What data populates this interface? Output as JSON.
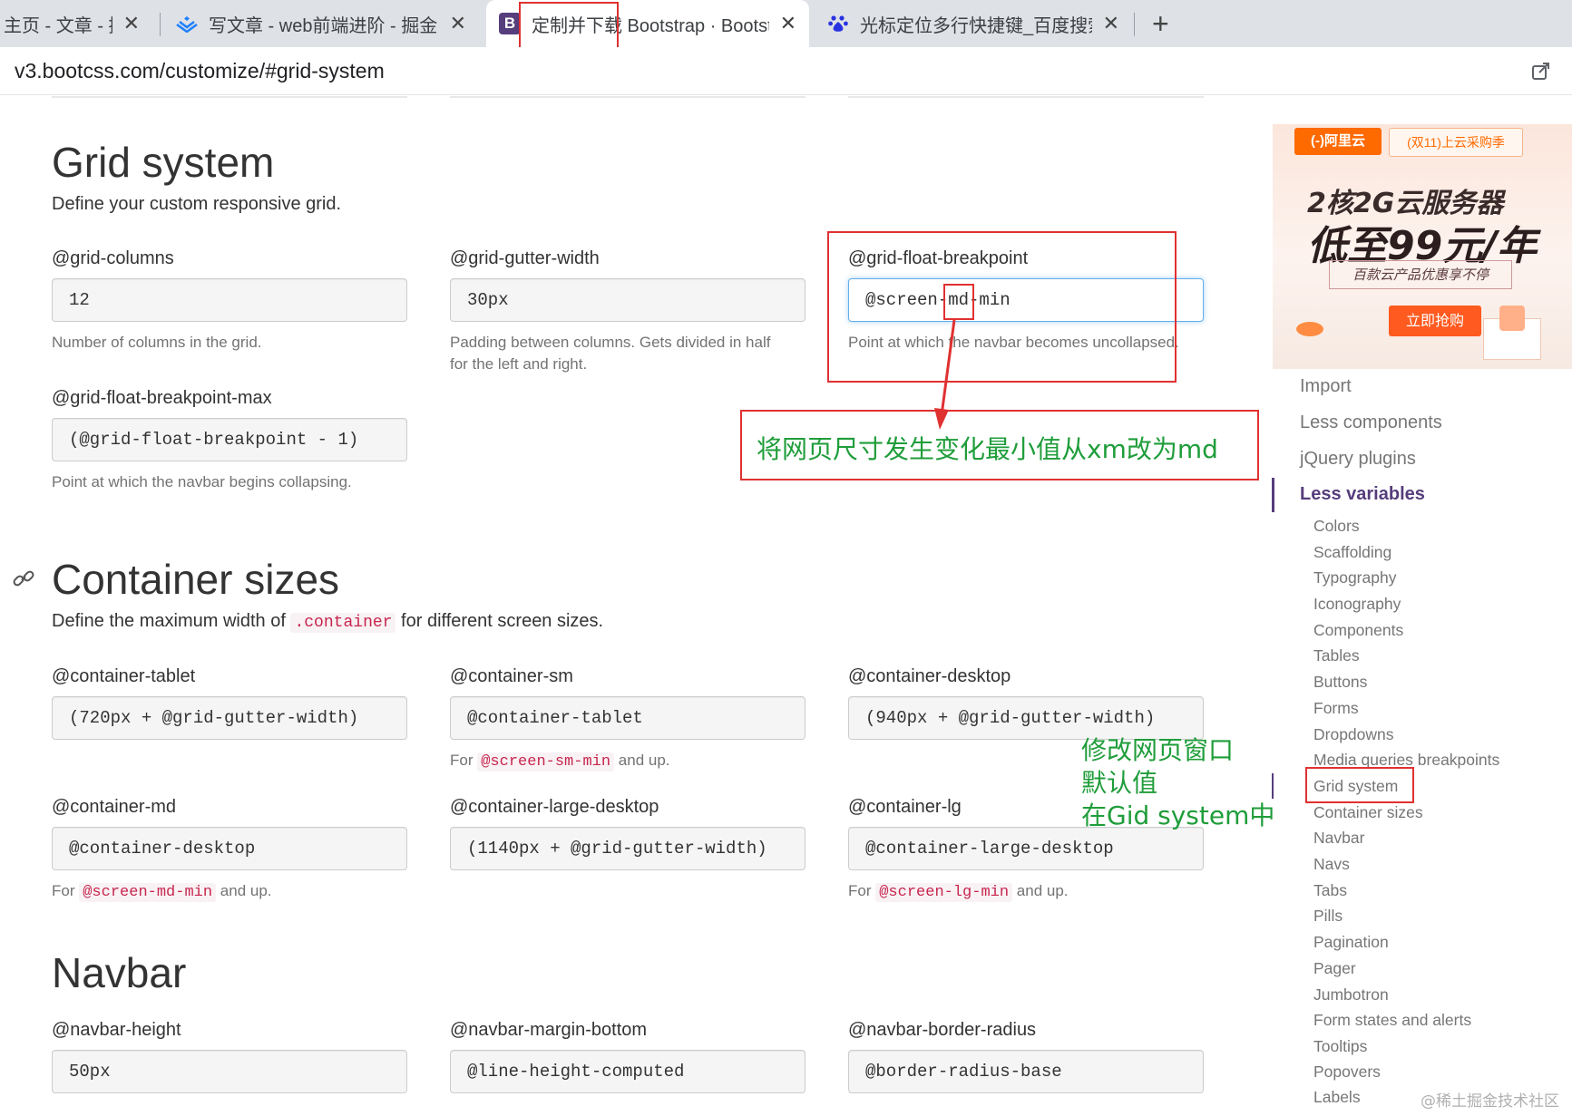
{
  "browser": {
    "tabs": [
      {
        "title": "主页 - 文章 - 掘"
      },
      {
        "title": "写文章 - web前端进阶 - 掘金"
      },
      {
        "title": "定制并下载 Bootstrap · Bootstrap"
      },
      {
        "title": "光标定位多行快捷键_百度搜索"
      }
    ],
    "tab_close": "✕",
    "new_tab": "+",
    "active_favicon": "B",
    "address": "v3.bootcss.com/customize/#grid-system"
  },
  "grid": {
    "title": "Grid system",
    "lead": "Define your custom responsive grid.",
    "columns": {
      "label": "@grid-columns",
      "value": "12",
      "help": "Number of columns in the grid."
    },
    "gutter": {
      "label": "@grid-gutter-width",
      "value": "30px",
      "help1": "Padding between columns. Gets divided in half",
      "help2": "for the left and right."
    },
    "float": {
      "label": "@grid-float-breakpoint",
      "value": "@screen-md-min",
      "help": "Point at which the navbar becomes uncollapsed."
    },
    "float_max": {
      "label": "@grid-float-breakpoint-max",
      "value": "(@grid-float-breakpoint - 1)",
      "help": "Point at which the navbar begins collapsing."
    }
  },
  "container": {
    "title": "Container sizes",
    "lead_before": "Define the maximum width of",
    "lead_code": ".container",
    "lead_after": "for different screen sizes.",
    "tablet": {
      "label": "@container-tablet",
      "value": "(720px + @grid-gutter-width)"
    },
    "sm": {
      "label": "@container-sm",
      "value": "@container-tablet",
      "help_before": "For",
      "help_code": "@screen-sm-min",
      "help_after": "and up."
    },
    "desktop": {
      "label": "@container-desktop",
      "value": "(940px + @grid-gutter-width)"
    },
    "md": {
      "label": "@container-md",
      "value": "@container-desktop",
      "help_before": "For",
      "help_code": "@screen-md-min",
      "help_after": "and up."
    },
    "large_desktop": {
      "label": "@container-large-desktop",
      "value": "(1140px + @grid-gutter-width)"
    },
    "lg": {
      "label": "@container-lg",
      "value": "@container-large-desktop",
      "help_before": "For",
      "help_code": "@screen-lg-min",
      "help_after": "and up."
    }
  },
  "navbar": {
    "title": "Navbar",
    "height": {
      "label": "@navbar-height",
      "value": "50px"
    },
    "margin": {
      "label": "@navbar-margin-bottom",
      "value": "@line-height-computed"
    },
    "radius": {
      "label": "@navbar-border-radius",
      "value": "@border-radius-base"
    }
  },
  "annotations": {
    "note1": "将网页尺寸发生变化最小值从xm改为md",
    "note2_line1": "修改网页窗口",
    "note2_line2": "默认值",
    "note2_line3": "在Gid system中"
  },
  "ad": {
    "logo": "(-)阿里云",
    "tag": "(双11)上云采购季",
    "headline1": "2核2G云服务器",
    "headline2": "低至99元/年",
    "subline": "百款云产品优惠享不停",
    "button": "立即抢购"
  },
  "sidebar": {
    "top_items": [
      "Import",
      "Less components",
      "jQuery plugins"
    ],
    "active": "Less variables",
    "sub_items": [
      "Colors",
      "Scaffolding",
      "Typography",
      "Iconography",
      "Components",
      "Tables",
      "Buttons",
      "Forms",
      "Dropdowns",
      "Media queries breakpoints",
      "Grid system",
      "Container sizes",
      "Navbar",
      "Navs",
      "Tabs",
      "Pills",
      "Pagination",
      "Pager",
      "Jumbotron",
      "Form states and alerts",
      "Tooltips",
      "Popovers",
      "Labels"
    ]
  },
  "watermark": "@稀土掘金技术社区",
  "colors": {
    "annotation_red": "#e03131",
    "annotation_green": "#1f9d3a",
    "bootstrap_purple": "#563d7c",
    "code_red": "#c7254e"
  }
}
